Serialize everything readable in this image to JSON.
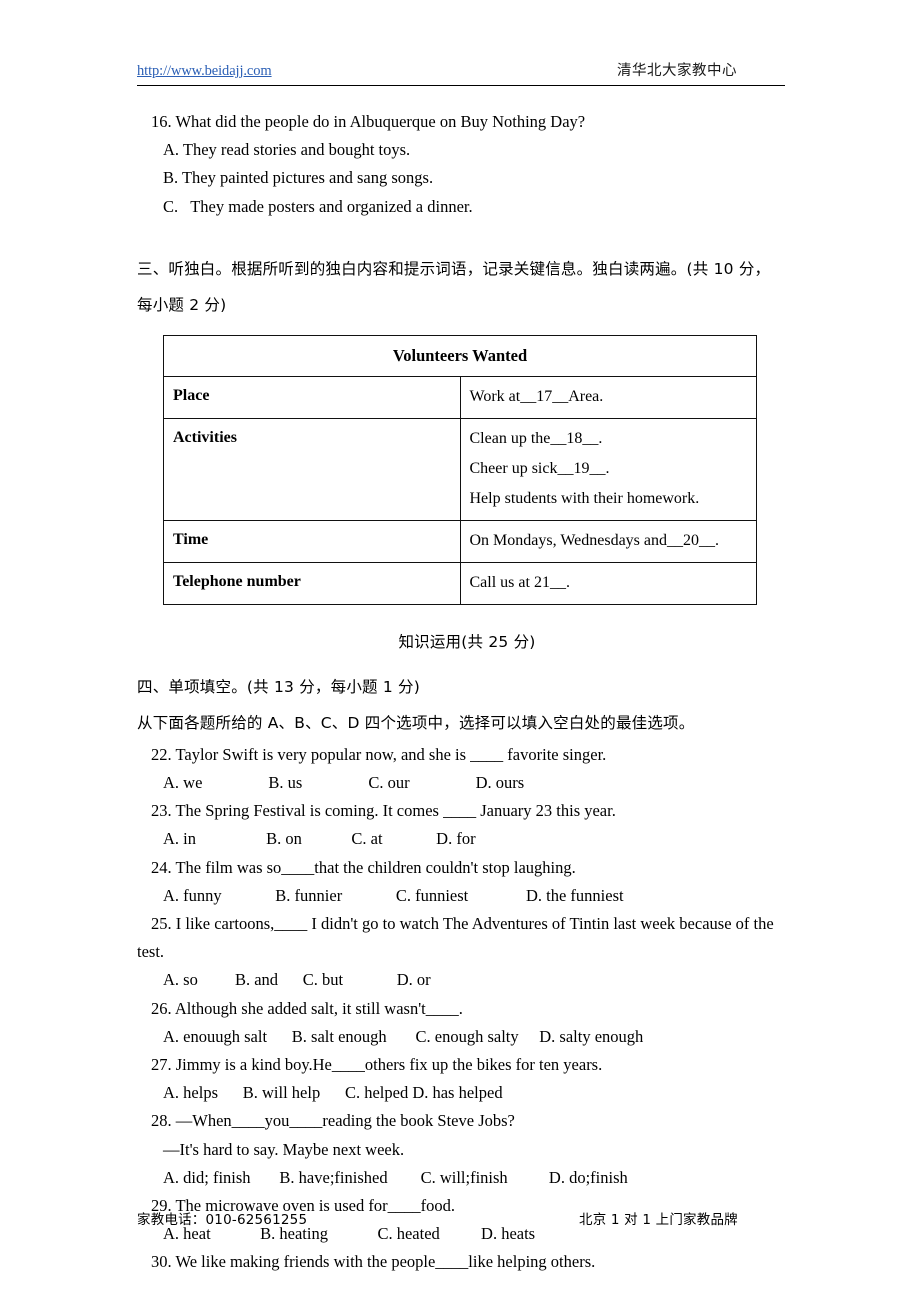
{
  "header": {
    "url": "http://www.beidajj.com",
    "org": "清华北大家教中心"
  },
  "footer": {
    "phone": "家教电话：010-62561255",
    "slogan": "北京 1 对 1 上门家教品牌"
  },
  "listening": {
    "q16": {
      "stem": "16. What did the people do in Albuquerque on Buy Nothing Day?",
      "a": "A. They read stories and bought toys.",
      "b": "B. They painted pictures and sang songs.",
      "c": "C.   They made posters and organized a dinner."
    },
    "section3_line1": "三、听独白。根据所听到的独白内容和提示词语，记录关键信息。独白读两遍。(共 10 分，",
    "section3_line2": "每小题 2 分)"
  },
  "table": {
    "title": "Volunteers Wanted",
    "rows": [
      {
        "label": "Place",
        "lines": [
          "Work at__17__Area."
        ]
      },
      {
        "label": "Activities",
        "lines": [
          "Clean up the__18__.",
          "Cheer up sick__19__.",
          "Help students with their homework."
        ]
      },
      {
        "label": "Time",
        "lines": [
          "On Mondays, Wednesdays and__20__."
        ]
      },
      {
        "label": "Telephone number",
        "lines": [
          "Call us at 21__."
        ]
      }
    ]
  },
  "knowledge": {
    "heading": "知识运用(共 25 分)",
    "section4": "四、单项填空。(共 13 分，每小题 1 分)",
    "instruction": "从下面各题所给的 A、B、C、D 四个选项中，选择可以填入空白处的最佳选项。"
  },
  "questions": [
    {
      "stem": "22. Taylor Swift is very popular now, and she is ____ favorite singer.",
      "options": "A. we                B. us                C. our                D. ours"
    },
    {
      "stem": "23. The Spring Festival is coming. It comes ____ January 23 this year.",
      "options": "A. in                 B. on            C. at             D. for"
    },
    {
      "stem": "24. The film was so____that the children couldn't stop laughing.",
      "options": "A. funny             B. funnier             C. funniest              D. the funniest"
    },
    {
      "stem": "25. I like cartoons,____ I didn't go to watch The Adventures of Tintin last week because of the",
      "stem_cont": "test.",
      "options": "A. so         B. and      C. but             D. or"
    },
    {
      "stem": "26. Although she added salt, it still wasn't____.",
      "options": "A. enouugh salt      B. salt enough       C. enough salty     D. salty enough"
    },
    {
      "stem": "27. Jimmy is a kind boy.He____others fix up the bikes for ten years.",
      "options": "A. helps      B. will help      C. helped D. has helped"
    },
    {
      "stem": "28. —When____you____reading the book Steve Jobs?",
      "stem_cont": "—It's hard to say. Maybe next week.",
      "options": "A. did; finish       B. have;finished        C. will;finish          D. do;finish"
    },
    {
      "stem": "29. The microwave oven is used for____food.",
      "options": "A. heat            B. heating            C. heated          D. heats"
    },
    {
      "stem": "30. We like making friends with the people____like helping others.",
      "options": ""
    }
  ]
}
